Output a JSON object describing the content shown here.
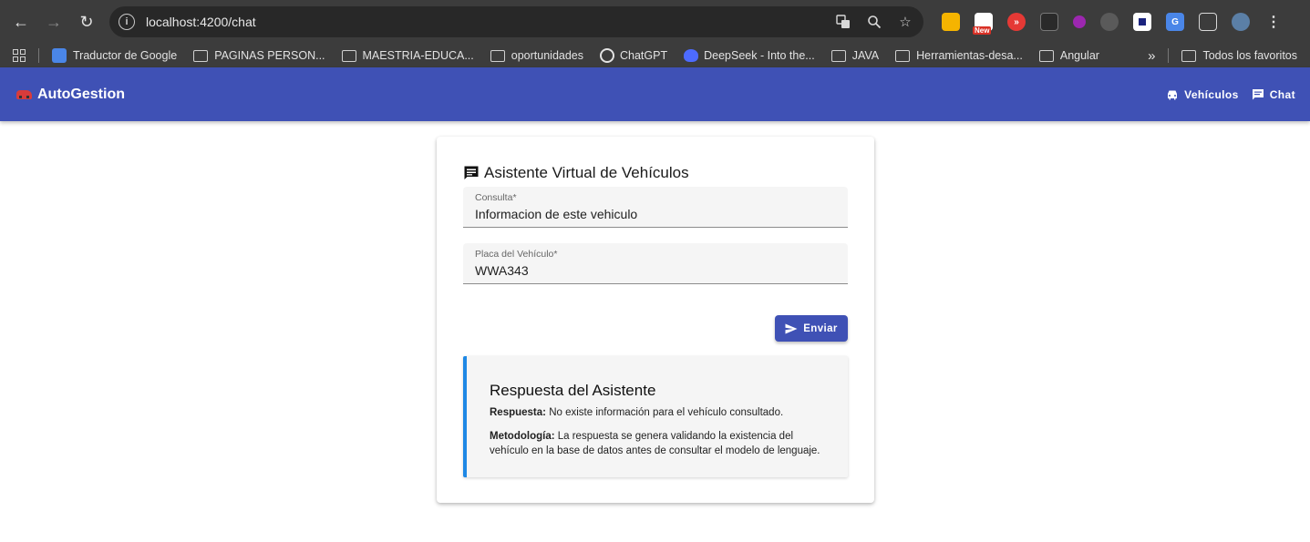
{
  "browser": {
    "url": "localhost:4200/chat",
    "extension_badge": "New",
    "bookmarks": [
      {
        "label": "Traductor de Google",
        "kind": "google-translate"
      },
      {
        "label": "PAGINAS PERSON...",
        "kind": "folder"
      },
      {
        "label": "MAESTRIA-EDUCA...",
        "kind": "folder"
      },
      {
        "label": "oportunidades",
        "kind": "folder"
      },
      {
        "label": "ChatGPT",
        "kind": "chatgpt"
      },
      {
        "label": "DeepSeek - Into the...",
        "kind": "deepseek"
      },
      {
        "label": "JAVA",
        "kind": "folder"
      },
      {
        "label": "Herramientas-desa...",
        "kind": "folder"
      },
      {
        "label": "Angular",
        "kind": "folder"
      }
    ],
    "bookmarks_overflow": "»",
    "all_bookmarks": "Todos los favoritos"
  },
  "app": {
    "brand": "AutoGestion",
    "nav": {
      "vehicles": "Vehículos",
      "chat": "Chat"
    }
  },
  "chat": {
    "title": "Asistente Virtual de Vehículos",
    "query_label": "Consulta*",
    "query_value": "Informacion de este vehiculo",
    "plate_label": "Placa del Vehículo*",
    "plate_value": "WWA343",
    "send_label": "Enviar",
    "response": {
      "title": "Respuesta del Asistente",
      "answer_label": "Respuesta:",
      "answer_text": " No existe información para el vehículo consultado.",
      "method_label": "Metodología:",
      "method_text": " La respuesta se genera validando la existencia del vehículo en la base de datos antes de consultar el modelo de lenguaje."
    }
  },
  "colors": {
    "primary": "#3f51b5",
    "accent_border": "#1e88e5",
    "chrome_bg": "#3c3c3c"
  }
}
